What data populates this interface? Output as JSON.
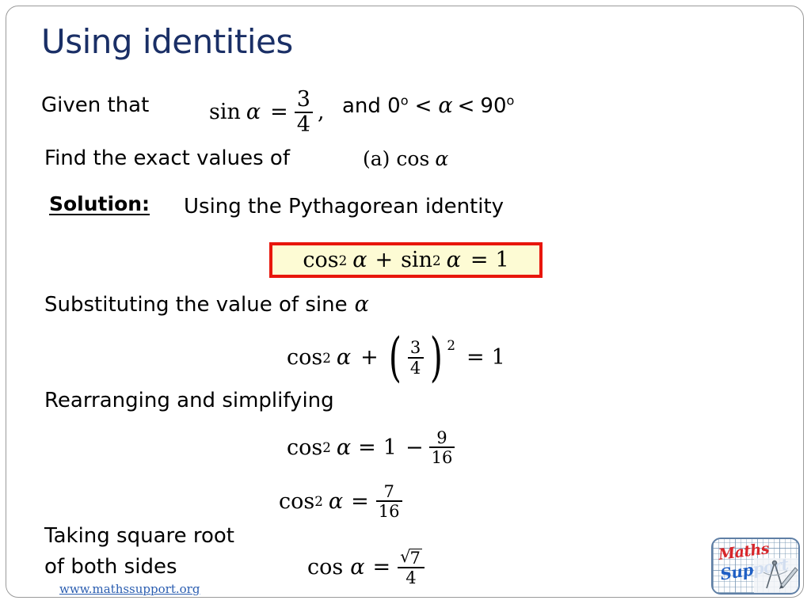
{
  "slide": {
    "title": "Using identities",
    "title_color": "#1a2f66",
    "background": "#ffffff",
    "border_color": "#9a9a9a"
  },
  "given": {
    "lead_text": "Given that",
    "equation": {
      "func": "sin",
      "variable": "α",
      "equals": "=",
      "numerator": "3",
      "denominator": "4",
      "comma": ","
    },
    "range_text_prefix": "and 0",
    "degree": "o",
    "range_lt1": "<",
    "range_variable": "α",
    "range_lt2": "<",
    "range_max": "90"
  },
  "question": {
    "text": "Find the exact values of",
    "part_label": "(a)",
    "part_func": "cos",
    "part_variable": "α"
  },
  "solution": {
    "label": "Solution:",
    "intro": "Using the Pythagorean identity",
    "identity_box": {
      "cos": "cos",
      "cos_power": "2",
      "var1": "α",
      "plus": "+",
      "sin": "sin",
      "sin_power": "2",
      "var2": "α",
      "equals": "=",
      "result": "1"
    },
    "identity_box_fill": "#fdfbd4",
    "identity_box_border": "#e8160c"
  },
  "substituting": {
    "text": "Substituting the value of sine",
    "variable": "α",
    "equation": {
      "cos": "cos",
      "cos_power": "2",
      "var": "α",
      "plus": "+",
      "frac_num": "3",
      "frac_den": "4",
      "paren_power": "2",
      "equals": "=",
      "result": "1"
    }
  },
  "rearranging": {
    "text": "Rearranging and simplifying",
    "equation1": {
      "cos": "cos",
      "cos_power": "2",
      "var": "α",
      "equals": "=",
      "one": "1",
      "minus": "−",
      "frac_num": "9",
      "frac_den": "16"
    },
    "equation2": {
      "cos": "cos",
      "cos_power": "2",
      "var": "α",
      "equals": "=",
      "frac_num": "7",
      "frac_den": "16"
    }
  },
  "final": {
    "text_line1": "Taking square root",
    "text_line2": "of both sides",
    "equation": {
      "cos": "cos",
      "var": "α",
      "equals": "=",
      "radical": "√",
      "radicand": "7",
      "denominator": "4"
    }
  },
  "footer": {
    "link_text": "www.mathssupport.org",
    "link_color": "#2a5db0"
  },
  "logo": {
    "word1": "Maths",
    "word2": "Support",
    "word1_color": "#d8262a",
    "word2_color": "#1f5fc4"
  }
}
